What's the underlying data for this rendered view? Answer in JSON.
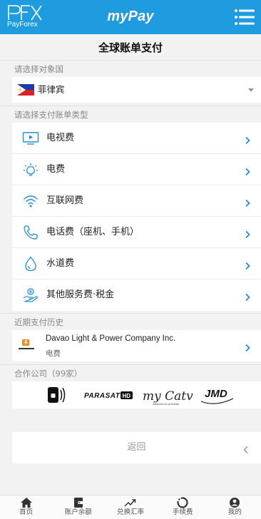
{
  "header": {
    "logo_text": "PFX",
    "logo_sub": "PayForex",
    "brand": "myPay"
  },
  "page_title": "全球账单支付",
  "country_section": {
    "label": "请选择对象国",
    "selected_country": "菲律宾",
    "flag_icon": "philippines-flag-icon"
  },
  "bill_section": {
    "label": "请选择支付账单类型",
    "items": [
      {
        "label": "电视费",
        "icon": "tv-icon"
      },
      {
        "label": "电费",
        "icon": "lightbulb-icon"
      },
      {
        "label": "互联网费",
        "icon": "wifi-icon"
      },
      {
        "label": "电话费（座机、手机）",
        "icon": "phone-icon"
      },
      {
        "label": "水道费",
        "icon": "water-drop-icon"
      },
      {
        "label": "其他服务费·税金",
        "icon": "service-tax-icon"
      }
    ]
  },
  "history_section": {
    "label": "近期支付历史",
    "items": [
      {
        "name": "Davao Light & Power Company Inc.",
        "category": "电费"
      }
    ]
  },
  "partners_section": {
    "label": "合作公司（99家）",
    "partners": [
      {
        "name": "Globe",
        "icon": "globe-logo"
      },
      {
        "name": "PARASAT HD",
        "text": "PARASAT",
        "badge": "HD"
      },
      {
        "name": "my Catv",
        "text": "my Catv",
        "tagline": "Kabandia mo sa Buhay!"
      },
      {
        "name": "JMD",
        "text": "JMD"
      }
    ]
  },
  "back_button": {
    "label": "返回"
  },
  "tabbar": [
    {
      "label": "首页",
      "icon": "home-icon"
    },
    {
      "label": "账户余额",
      "icon": "wallet-icon"
    },
    {
      "label": "兑换汇率",
      "icon": "trend-up-icon"
    },
    {
      "label": "手续费",
      "icon": "circle-arrows-icon"
    },
    {
      "label": "我的",
      "icon": "user-icon"
    }
  ],
  "colors": {
    "header_bg": "#1f9be0",
    "accent": "#1f8fd6",
    "background": "#f2f2f2"
  }
}
